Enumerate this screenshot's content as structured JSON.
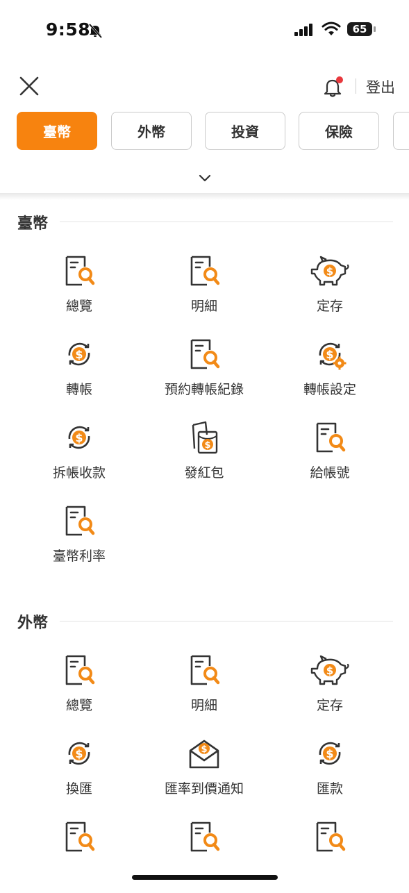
{
  "status_bar": {
    "time": "9:58",
    "battery": "65"
  },
  "header": {
    "logout_label": "登出"
  },
  "tabs": [
    {
      "label": "臺幣",
      "active": true
    },
    {
      "label": "外幣",
      "active": false
    },
    {
      "label": "投資",
      "active": false
    },
    {
      "label": "保險",
      "active": false
    },
    {
      "label": "",
      "active": false
    }
  ],
  "sections": [
    {
      "title": "臺幣",
      "items": [
        {
          "label": "總覽",
          "icon": "doc-search-icon"
        },
        {
          "label": "明細",
          "icon": "doc-search-icon"
        },
        {
          "label": "定存",
          "icon": "piggy-bank-icon"
        },
        {
          "label": "轉帳",
          "icon": "dollar-cycle-icon"
        },
        {
          "label": "預約轉帳紀錄",
          "icon": "doc-search-icon"
        },
        {
          "label": "轉帳設定",
          "icon": "dollar-cycle-gear-icon"
        },
        {
          "label": "拆帳收款",
          "icon": "dollar-cycle-icon"
        },
        {
          "label": "發紅包",
          "icon": "red-envelope-icon"
        },
        {
          "label": "給帳號",
          "icon": "doc-search-icon"
        },
        {
          "label": "臺幣利率",
          "icon": "doc-search-icon"
        }
      ]
    },
    {
      "title": "外幣",
      "items": [
        {
          "label": "總覽",
          "icon": "doc-search-icon"
        },
        {
          "label": "明細",
          "icon": "doc-search-icon"
        },
        {
          "label": "定存",
          "icon": "piggy-bank-icon"
        },
        {
          "label": "換匯",
          "icon": "dollar-cycle-icon"
        },
        {
          "label": "匯率到價通知",
          "icon": "mail-dollar-icon"
        },
        {
          "label": "匯款",
          "icon": "dollar-cycle-icon"
        },
        {
          "label": "",
          "icon": "doc-search-icon"
        },
        {
          "label": "",
          "icon": "doc-search-icon"
        },
        {
          "label": "",
          "icon": "doc-search-icon"
        }
      ]
    }
  ],
  "colors": {
    "accent": "#f7830f",
    "text": "#333333",
    "notification_dot": "#e8383d"
  }
}
